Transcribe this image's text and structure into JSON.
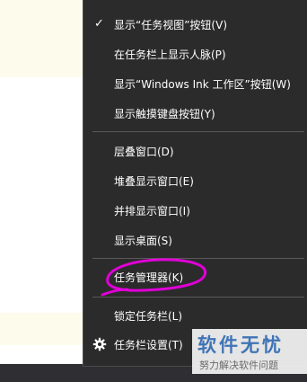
{
  "context_menu": {
    "items": [
      {
        "label": "显示“任务视图”按钮(V)",
        "checked": true
      },
      {
        "label": "在任务栏上显示人脉(P)"
      },
      {
        "label": "显示“Windows Ink 工作区”按钮(W)"
      },
      {
        "label": "显示触摸键盘按钮(Y)"
      },
      {
        "label": "层叠窗口(D)"
      },
      {
        "label": "堆叠显示窗口(E)"
      },
      {
        "label": "并排显示窗口(I)"
      },
      {
        "label": "显示桌面(S)"
      },
      {
        "label": "任务管理器(K)",
        "highlighted": true
      },
      {
        "label": "锁定任务栏(L)"
      },
      {
        "label": "任务栏设置(T)",
        "icon": "gear-icon"
      }
    ],
    "check_mark": "✓"
  },
  "watermark": {
    "title": "软件无忧",
    "subtitle": "努力解决软件问题"
  },
  "colors": {
    "menu_background": "#2b2b2b",
    "menu_text": "#ffffff",
    "separator": "#595959",
    "highlight_stroke": "#e000d8",
    "watermark_text": "#3f74b6"
  }
}
